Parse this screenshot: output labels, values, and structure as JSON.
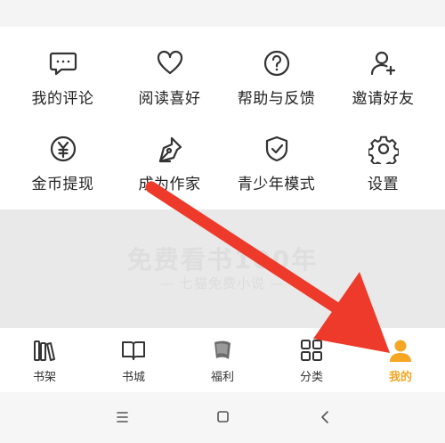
{
  "menu": {
    "row1": [
      {
        "label": "我的评论",
        "icon": "comment-icon"
      },
      {
        "label": "阅读喜好",
        "icon": "heart-icon"
      },
      {
        "label": "帮助与反馈",
        "icon": "help-icon"
      },
      {
        "label": "邀请好友",
        "icon": "add-user-icon"
      }
    ],
    "row2": [
      {
        "label": "金币提现",
        "icon": "coin-icon"
      },
      {
        "label": "成为作家",
        "icon": "pen-icon"
      },
      {
        "label": "青少年模式",
        "icon": "shield-check-icon"
      },
      {
        "label": "设置",
        "icon": "gear-icon"
      }
    ]
  },
  "banner": {
    "title": "免费看书100年",
    "subtitle": "— 七猫免费小说 —"
  },
  "tabs": [
    {
      "label": "书架",
      "icon": "bookshelf-icon"
    },
    {
      "label": "书城",
      "icon": "open-book-icon"
    },
    {
      "label": "福利",
      "icon": "gift-icon"
    },
    {
      "label": "分类",
      "icon": "category-grid-icon"
    },
    {
      "label": "我的",
      "icon": "profile-icon"
    }
  ],
  "colors": {
    "accent": "#f5a623",
    "annotation_arrow": "#ee3a2a",
    "icon_stroke": "#333333"
  }
}
